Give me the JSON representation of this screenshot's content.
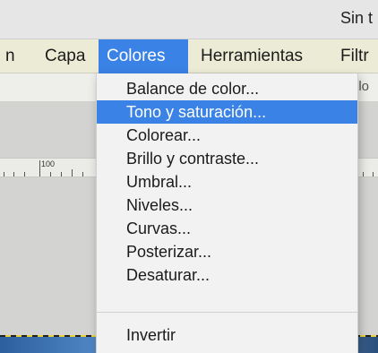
{
  "window": {
    "title": "Sin t"
  },
  "menubar": {
    "items": [
      {
        "label": "n"
      },
      {
        "label": "Capa"
      },
      {
        "label": "Colores"
      },
      {
        "label": "Herramientas"
      },
      {
        "label": "Filtr"
      }
    ],
    "active_item": "Colores"
  },
  "toolbar": {
    "fragment": "olo"
  },
  "ruler": {
    "label": "100"
  },
  "colors_menu": {
    "items": [
      {
        "label": "Balance de color..."
      },
      {
        "label": "Tono y saturación..."
      },
      {
        "label": "Colorear..."
      },
      {
        "label": "Brillo y contraste..."
      },
      {
        "label": "Umbral..."
      },
      {
        "label": "Niveles..."
      },
      {
        "label": "Curvas..."
      },
      {
        "label": "Posterizar..."
      },
      {
        "label": "Desaturar..."
      },
      {
        "label": "Invertir"
      }
    ],
    "highlighted_item": "Tono y saturación..."
  },
  "colors": {
    "accent": "#3b82e6",
    "menubar_bg": "#ececd6",
    "menu_bg": "#f2f2f2"
  }
}
